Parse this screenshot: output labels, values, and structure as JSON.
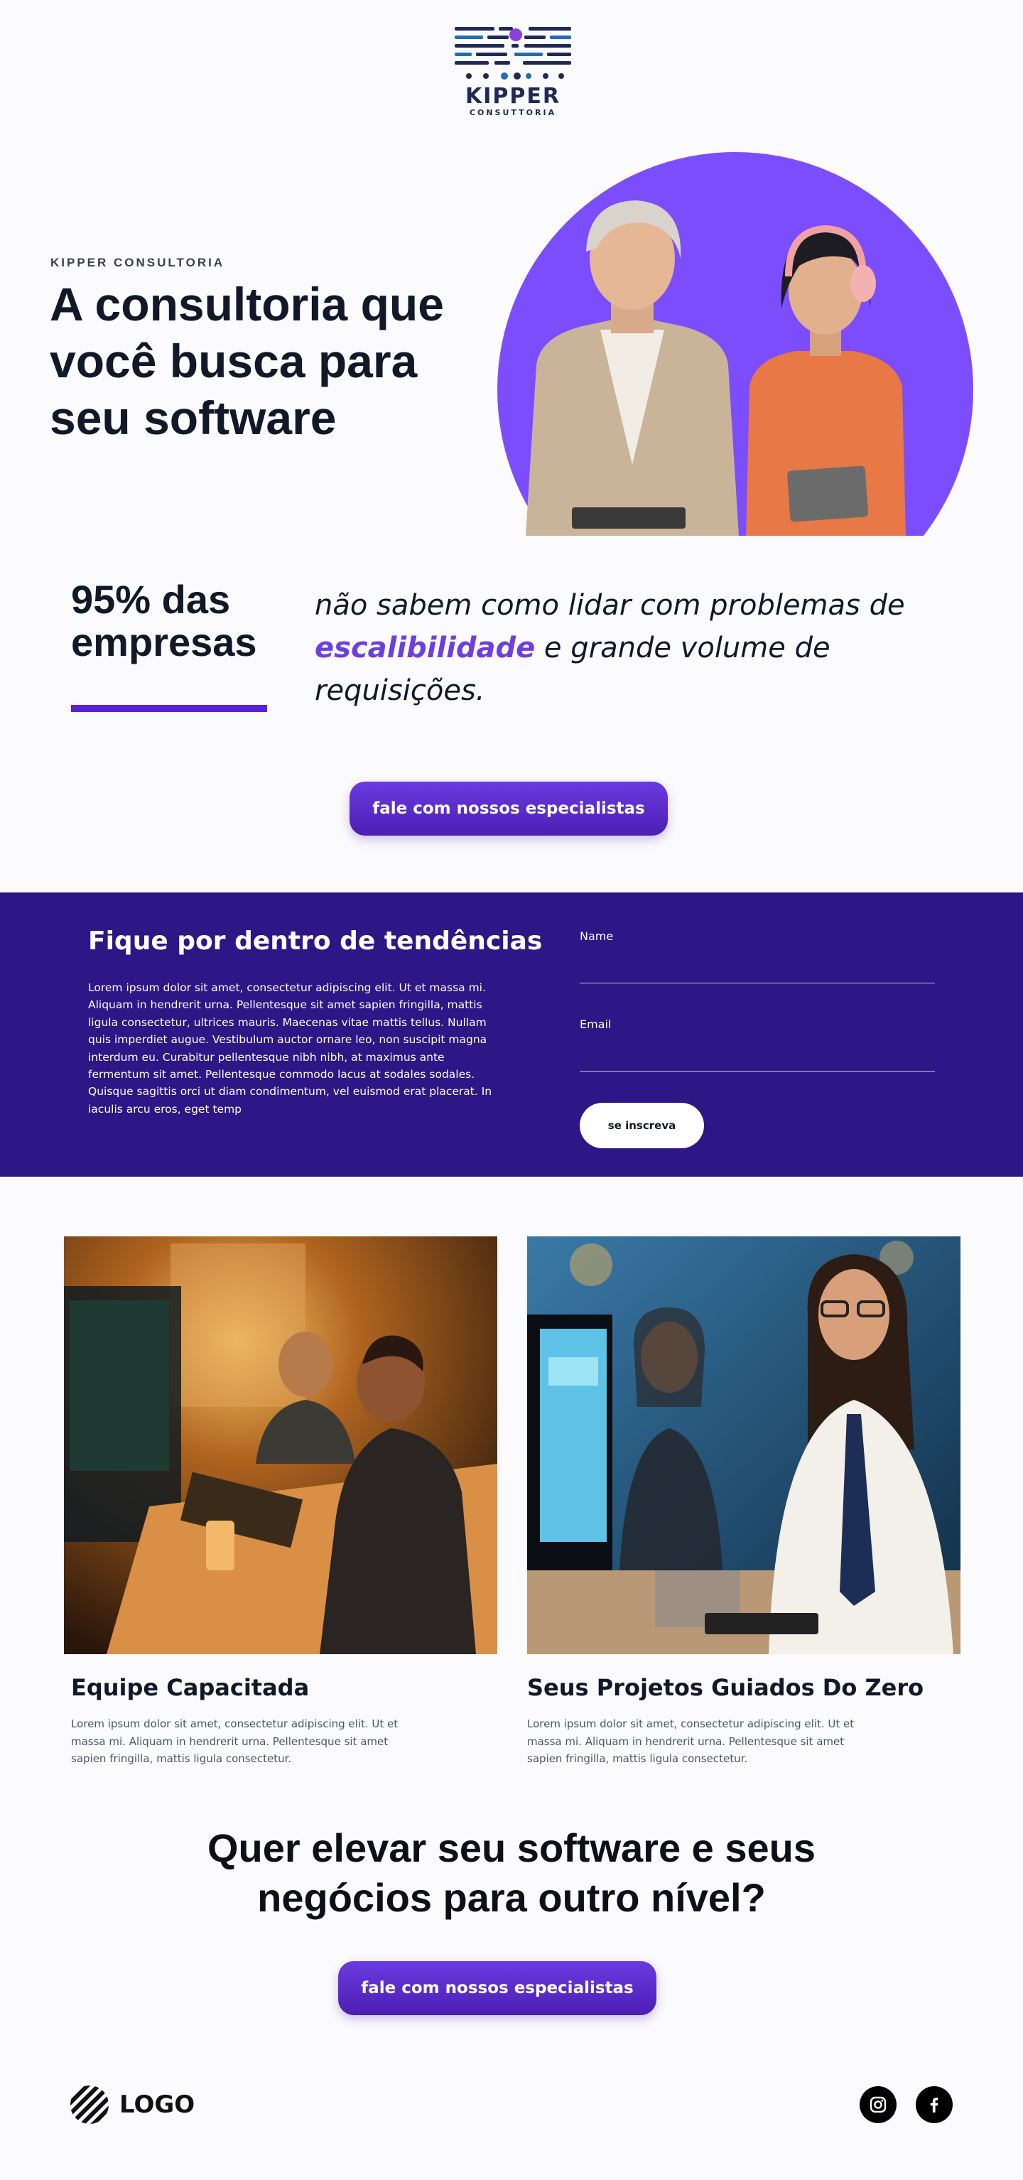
{
  "header": {
    "brand_name": "KIPPER",
    "brand_subtitle": "CONSUTTORIA"
  },
  "hero": {
    "eyebrow": "KIPPER CONSULTORIA",
    "title": "A consultoria que você busca para seu software"
  },
  "stats": {
    "headline": "95% das empresas",
    "text_before": "não sabem como lidar com problemas de ",
    "highlight": "escalibilidade",
    "text_after": " e grande volume de requisições."
  },
  "cta_top": {
    "label": "fale com nossos especialistas"
  },
  "newsletter": {
    "title": "Fique por dentro de tendências",
    "body": "Lorem ipsum dolor sit amet, consectetur adipiscing elit. Ut et massa mi. Aliquam in hendrerit urna. Pellentesque sit amet sapien fringilla, mattis ligula consectetur, ultrices mauris. Maecenas vitae mattis tellus. Nullam quis imperdiet augue. Vestibulum auctor ornare leo, non suscipit magna interdum eu. Curabitur pellentesque nibh nibh, at maximus ante fermentum sit amet. Pellentesque commodo lacus at sodales sodales. Quisque sagittis orci ut diam condimentum, vel euismod erat placerat. In iaculis arcu eros, eget temp",
    "name_label": "Name",
    "email_label": "Email",
    "name_value": "",
    "email_value": "",
    "subscribe_label": "se inscreva"
  },
  "cards": [
    {
      "title": "Equipe Capacitada",
      "text": "Lorem ipsum dolor sit amet, consectetur adipiscing elit. Ut et massa mi. Aliquam in hendrerit urna. Pellentesque sit amet sapien fringilla, mattis ligula consectetur."
    },
    {
      "title": "Seus Projetos Guiados Do Zero",
      "text": "Lorem ipsum dolor sit amet, consectetur adipiscing elit. Ut et massa mi. Aliquam in hendrerit urna. Pellentesque sit amet sapien fringilla, mattis ligula consectetur."
    }
  ],
  "bottom": {
    "title": "Quer elevar seu software e seus negócios para outro nível?"
  },
  "cta_bottom": {
    "label": "fale com nossos especialistas"
  },
  "footer": {
    "logo_text": "LOGO",
    "social": [
      "instagram-icon",
      "facebook-icon"
    ]
  },
  "colors": {
    "accent": "#5b21d6",
    "newsletter_bg": "#2d1685",
    "hero_circle": "#7c4dfc",
    "highlight_text": "#6d3fe0"
  }
}
